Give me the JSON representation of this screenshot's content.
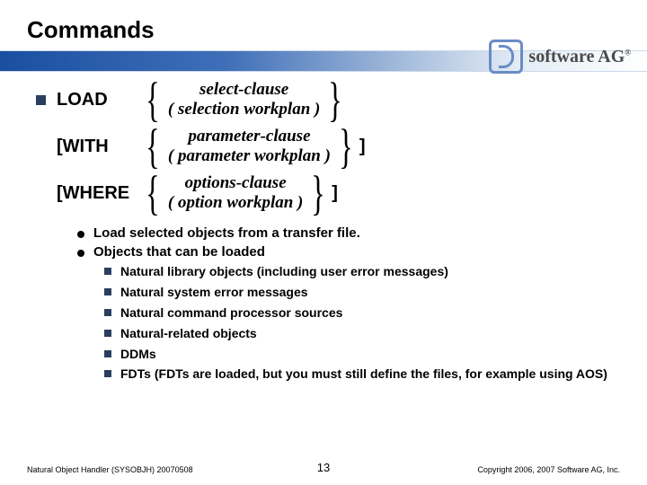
{
  "title": "Commands",
  "logo": {
    "prefix": "s",
    "mid": "of",
    "rest": "tware AG",
    "reg": "®"
  },
  "syntax": {
    "load": {
      "kw": "LOAD",
      "a1": "select-clause",
      "a2": "( selection workplan )"
    },
    "with": {
      "kw": "[WITH",
      "a1": "parameter-clause",
      "a2": "( parameter workplan )",
      "trail": "]"
    },
    "where": {
      "kw": "[WHERE",
      "a1": "options-clause",
      "a2": "( option workplan )",
      "trail": "]"
    }
  },
  "desc": {
    "b1": "Load selected objects from a transfer file.",
    "b2": "Objects that can be loaded",
    "sub": {
      "s0": "Natural library objects (including user error messages)",
      "s1": "Natural system error messages",
      "s2": "Natural command processor sources",
      "s3": "Natural-related objects",
      "s4": "DDMs",
      "s5": "FDTs (FDTs are loaded, but you must still define the files, for example using AOS)"
    }
  },
  "footer": {
    "left": "Natural Object Handler (SYSOBJH) 20070508",
    "page": "13",
    "right": "Copyright 2006, 2007 Software AG, Inc."
  }
}
